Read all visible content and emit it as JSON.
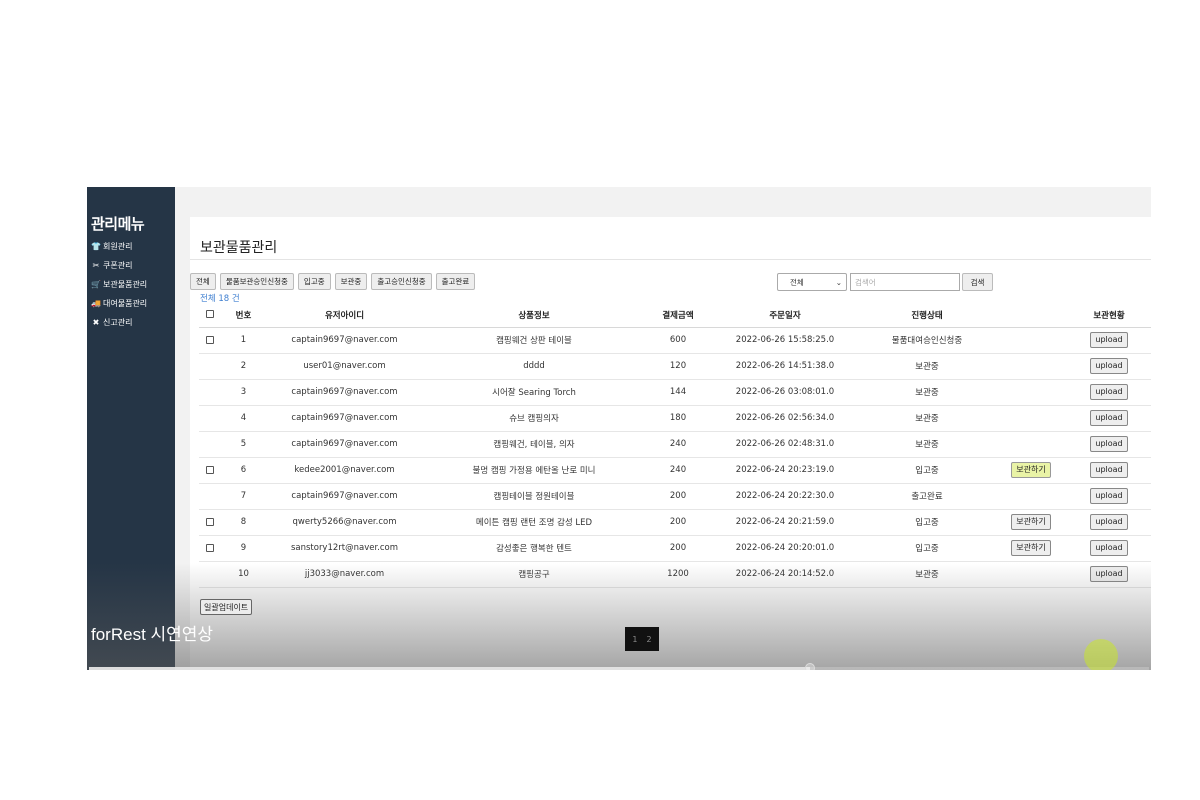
{
  "sidebar": {
    "title": "관리메뉴",
    "items": [
      {
        "icon": "shirt-icon",
        "glyph": "👕",
        "label": "회원관리"
      },
      {
        "icon": "scissors-icon",
        "glyph": "✂",
        "label": "쿠폰관리"
      },
      {
        "icon": "cart-icon",
        "glyph": "🛒",
        "label": "보관물품관리"
      },
      {
        "icon": "truck-icon",
        "glyph": "🚚",
        "label": "대여물품관리"
      },
      {
        "icon": "wrench-icon",
        "glyph": "✖",
        "label": "신고관리"
      }
    ]
  },
  "page": {
    "title": "보관물품관리"
  },
  "filters": [
    "전체",
    "물품보관승인신청중",
    "입고중",
    "보관중",
    "출고승인신청중",
    "출고완료"
  ],
  "search": {
    "select_value": "전체",
    "placeholder": "검색어",
    "button_label": "검색"
  },
  "total_label": "전체 18 건",
  "table": {
    "headers": [
      "번호",
      "유저아이디",
      "상품정보",
      "결제금액",
      "주문일자",
      "진행상태",
      "보관현황"
    ],
    "rows": [
      {
        "checkbox": true,
        "no": "1",
        "user": "captain9697@naver.com",
        "product": "캠핑웨건 상판 테이블",
        "amount": "600",
        "date": "2022-06-26 15:58:25.0",
        "status": "물품대여승인신청중",
        "action": "",
        "upload": "upload"
      },
      {
        "checkbox": false,
        "no": "2",
        "user": "user01@naver.com",
        "product": "dddd",
        "amount": "120",
        "date": "2022-06-26 14:51:38.0",
        "status": "보관중",
        "action": "",
        "upload": "upload"
      },
      {
        "checkbox": false,
        "no": "3",
        "user": "captain9697@naver.com",
        "product": "시어잘 Searing Torch",
        "amount": "144",
        "date": "2022-06-26 03:08:01.0",
        "status": "보관중",
        "action": "",
        "upload": "upload"
      },
      {
        "checkbox": false,
        "no": "4",
        "user": "captain9697@naver.com",
        "product": "슈브 캠핑의자",
        "amount": "180",
        "date": "2022-06-26 02:56:34.0",
        "status": "보관중",
        "action": "",
        "upload": "upload"
      },
      {
        "checkbox": false,
        "no": "5",
        "user": "captain9697@naver.com",
        "product": "캠핑웨건, 테이블, 의자",
        "amount": "240",
        "date": "2022-06-26 02:48:31.0",
        "status": "보관중",
        "action": "",
        "upload": "upload"
      },
      {
        "checkbox": true,
        "no": "6",
        "user": "kedee2001@naver.com",
        "product": "불멍 캠핑 가정용 에탄올 난로 미니",
        "amount": "240",
        "date": "2022-06-24 20:23:19.0",
        "status": "입고중",
        "action": "보관하기",
        "upload": "upload"
      },
      {
        "checkbox": false,
        "no": "7",
        "user": "captain9697@naver.com",
        "product": "캠핑테이블 정원테이블",
        "amount": "200",
        "date": "2022-06-24 20:22:30.0",
        "status": "출고완료",
        "action": "",
        "upload": "upload"
      },
      {
        "checkbox": true,
        "no": "8",
        "user": "qwerty5266@naver.com",
        "product": "메이튼 캠핑 랜턴 조명 감성 LED",
        "amount": "200",
        "date": "2022-06-24 20:21:59.0",
        "status": "입고중",
        "action": "보관하기",
        "upload": "upload"
      },
      {
        "checkbox": true,
        "no": "9",
        "user": "sanstory12rt@naver.com",
        "product": "감성좋은 행복한 텐트",
        "amount": "200",
        "date": "2022-06-24 20:20:01.0",
        "status": "입고중",
        "action": "보관하기",
        "upload": "upload"
      },
      {
        "checkbox": false,
        "no": "10",
        "user": "jj3033@naver.com",
        "product": "캠핑공구",
        "amount": "1200",
        "date": "2022-06-24 20:14:52.0",
        "status": "보관중",
        "action": "",
        "upload": "upload"
      }
    ]
  },
  "bulk_update_label": "일괄업데이트",
  "pagination": [
    "1",
    "2"
  ],
  "video": {
    "title": "forRest 시연연상",
    "progress": 0.68
  }
}
